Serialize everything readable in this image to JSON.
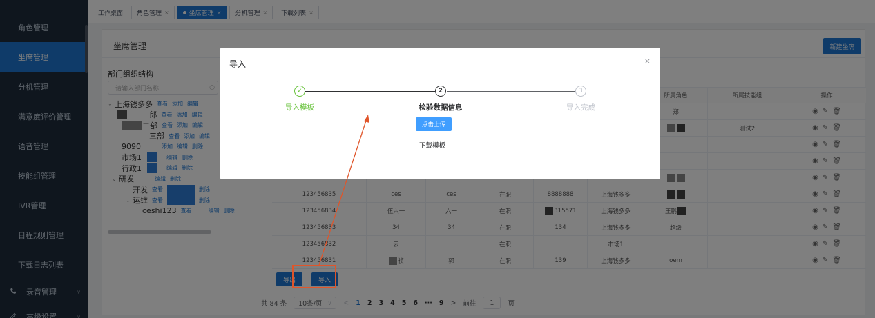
{
  "sidebar": {
    "items": [
      {
        "label": "角色管理",
        "icon": "",
        "active": false
      },
      {
        "label": "坐席管理",
        "icon": "",
        "active": true
      },
      {
        "label": "分机管理",
        "icon": "",
        "active": false
      },
      {
        "label": "满意度评价管理",
        "icon": "",
        "active": false
      },
      {
        "label": "语音管理",
        "icon": "",
        "active": false
      },
      {
        "label": "技能组管理",
        "icon": "",
        "active": false
      },
      {
        "label": "IVR管理",
        "icon": "",
        "active": false
      },
      {
        "label": "日程规则管理",
        "icon": "",
        "active": false
      },
      {
        "label": "下载日志列表",
        "icon": "",
        "active": false
      },
      {
        "label": "录音管理",
        "icon": "phone-icon",
        "active": false
      },
      {
        "label": "高级设置",
        "icon": "settings-icon",
        "active": false
      }
    ]
  },
  "tabs": [
    {
      "label": "工作桌面",
      "closable": false,
      "active": false
    },
    {
      "label": "角色管理",
      "closable": true,
      "active": false
    },
    {
      "label": "坐席管理",
      "closable": true,
      "active": true
    },
    {
      "label": "分机管理",
      "closable": true,
      "active": false
    },
    {
      "label": "下载列表",
      "closable": true,
      "active": false
    }
  ],
  "page": {
    "title": "坐席管理",
    "new_button": "新建坐席",
    "org_title": "部门组织结构",
    "org_search_placeholder": "请输入部门名称",
    "export_button": "导出",
    "import_button": "导入"
  },
  "tree": {
    "root": "上海钱多多",
    "actions": {
      "view": "查看",
      "add": "添加",
      "edit": "编辑",
      "delete": "删除"
    },
    "nodes": [
      "二部",
      "9090",
      "市场1",
      "行政1",
      "研发",
      "开发",
      "运维",
      "ceshi123"
    ]
  },
  "table": {
    "headers": [
      "",
      "",
      "",
      "",
      "",
      "",
      "",
      "所属角色",
      "所属技能组",
      "操作"
    ],
    "visible_headers": {
      "role": "所属角色",
      "skill": "所属技能组",
      "ops": "操作"
    },
    "top_rows": [
      {
        "role": "郑",
        "skill": ""
      },
      {
        "role": "",
        "skill": "测试2"
      },
      {
        "role": "",
        "skill": ""
      },
      {
        "role": "",
        "skill": ""
      },
      {
        "role": "",
        "skill": ""
      }
    ],
    "rows": [
      {
        "id": "123456835",
        "name": "ces",
        "nick": "ces",
        "status": "在职",
        "ext": "8888888",
        "dept": "上海钱多多",
        "role": ""
      },
      {
        "id": "123456834",
        "name": "伍六一",
        "nick": "六一",
        "status": "在职",
        "ext": "315571",
        "dept": "上海钱多多",
        "role": "王鹏"
      },
      {
        "id": "123456833",
        "name": "34",
        "nick": "34",
        "status": "在职",
        "ext": "134",
        "dept": "上海钱多多",
        "role": "超级"
      },
      {
        "id": "123456832",
        "name": "云",
        "nick": "",
        "status": "在职",
        "ext": "",
        "dept": "市场1",
        "role": ""
      },
      {
        "id": "123456831",
        "name": "祯",
        "nick": "郭",
        "status": "在职",
        "ext": "139",
        "dept": "上海钱多多",
        "role": "oem"
      }
    ]
  },
  "pager": {
    "total": "共 84 条",
    "size": "10条/页",
    "pages": [
      "1",
      "2",
      "3",
      "4",
      "5",
      "6",
      "···",
      "9"
    ],
    "current": "1",
    "goto_prefix": "前往",
    "goto_value": "1",
    "goto_suffix": "页"
  },
  "modal": {
    "title": "导入",
    "steps": [
      {
        "num": "✓",
        "label": "导入模板",
        "state": "done"
      },
      {
        "num": "2",
        "label": "检验数据信息",
        "state": "active"
      },
      {
        "num": "3",
        "label": "导入完成",
        "state": "pending"
      }
    ],
    "upload_button": "点击上传",
    "download_link": "下载模板"
  },
  "colors": {
    "primary": "#1e77d3",
    "success": "#67c23a",
    "annotation": "#e0552a",
    "sidebar_bg": "#1f2d3d"
  }
}
